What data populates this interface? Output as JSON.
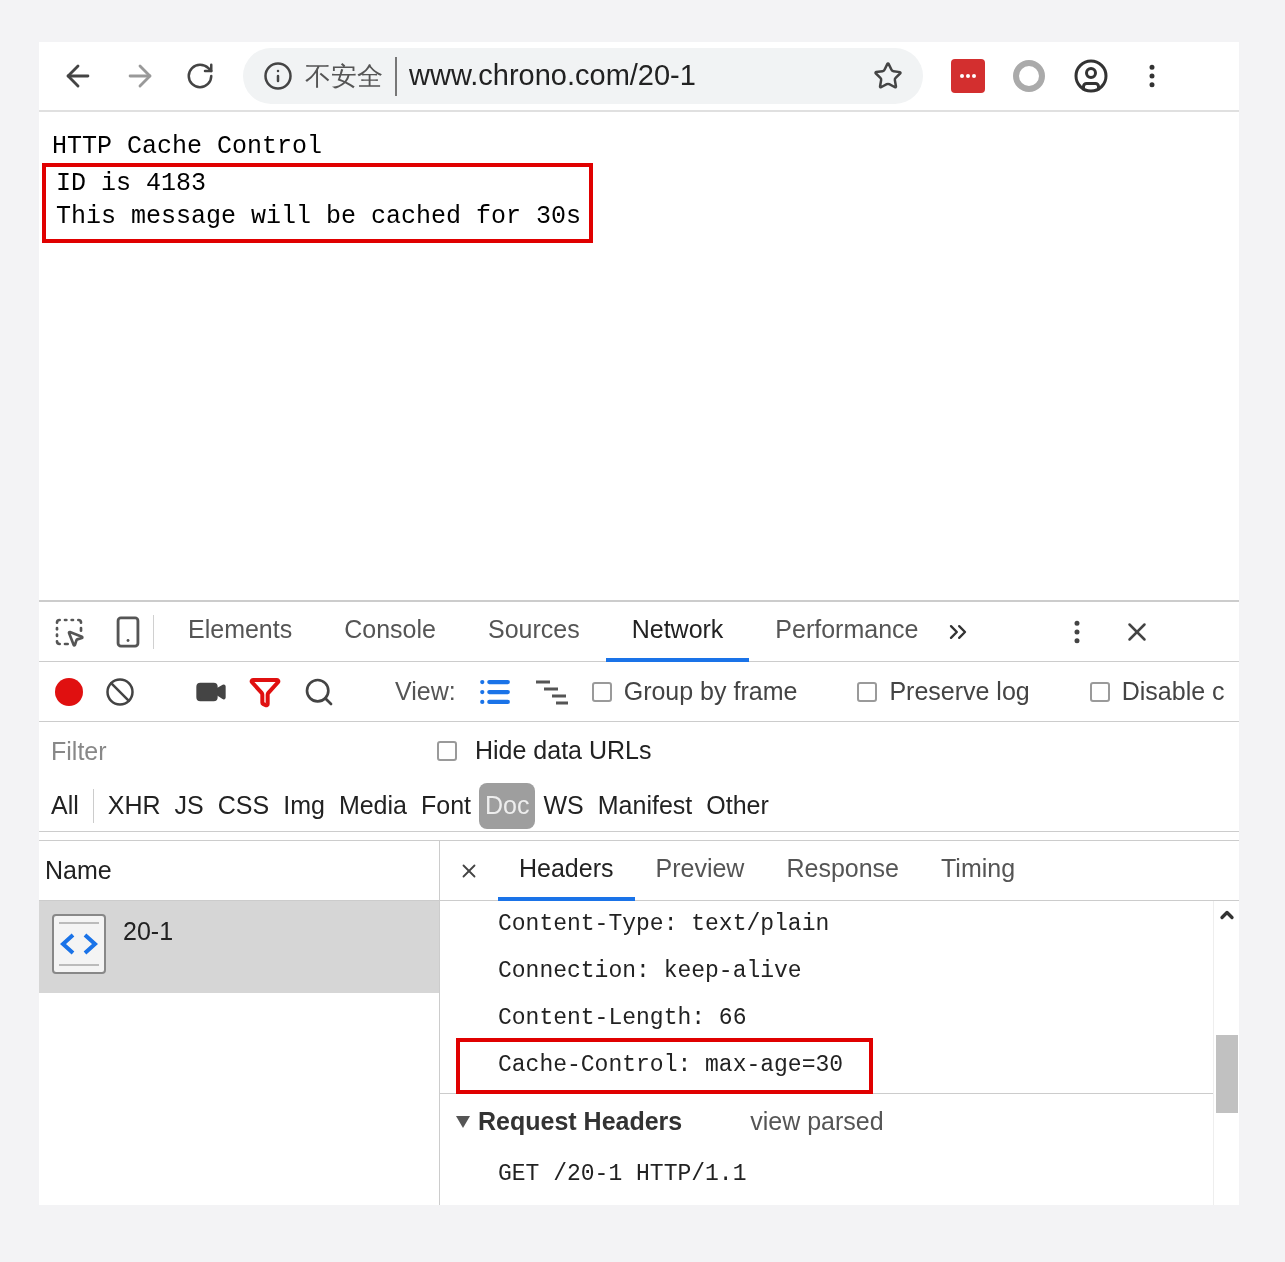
{
  "browser": {
    "security_label": "不安全",
    "url": "www.chrono.com/20-1"
  },
  "page": {
    "title": "HTTP Cache Control",
    "highlighted_lines": [
      "ID is 4183",
      "This message will be cached for 30s"
    ]
  },
  "devtools": {
    "tabs": [
      {
        "label": "Elements",
        "selected": false
      },
      {
        "label": "Console",
        "selected": false
      },
      {
        "label": "Sources",
        "selected": false
      },
      {
        "label": "Network",
        "selected": true
      },
      {
        "label": "Performance",
        "selected": false
      }
    ],
    "toolbar": {
      "recording": true,
      "filter_active": true,
      "view_label": "View:",
      "large_rows": true,
      "checkboxes": [
        {
          "label": "Group by frame",
          "checked": false
        },
        {
          "label": "Preserve log",
          "checked": false
        },
        {
          "label": "Disable c",
          "checked": false
        }
      ]
    },
    "filter": {
      "placeholder": "Filter",
      "hide_data_urls": {
        "label": "Hide data URLs",
        "checked": false
      }
    },
    "types": [
      {
        "label": "All",
        "selected": false
      },
      {
        "label": "XHR",
        "selected": false
      },
      {
        "label": "JS",
        "selected": false
      },
      {
        "label": "CSS",
        "selected": false
      },
      {
        "label": "Img",
        "selected": false
      },
      {
        "label": "Media",
        "selected": false
      },
      {
        "label": "Font",
        "selected": false
      },
      {
        "label": "Doc",
        "selected": true
      },
      {
        "label": "WS",
        "selected": false
      },
      {
        "label": "Manifest",
        "selected": false
      },
      {
        "label": "Other",
        "selected": false
      }
    ],
    "name_column": "Name",
    "requests": [
      {
        "name": "20-1",
        "selected": true
      }
    ],
    "detail_tabs": [
      {
        "label": "Headers",
        "selected": true
      },
      {
        "label": "Preview",
        "selected": false
      },
      {
        "label": "Response",
        "selected": false
      },
      {
        "label": "Timing",
        "selected": false
      }
    ],
    "response_headers": [
      {
        "text": "Content-Type: text/plain",
        "highlighted": false
      },
      {
        "text": "Connection: keep-alive",
        "highlighted": false
      },
      {
        "text": "Content-Length: 66",
        "highlighted": false
      },
      {
        "text": "Cache-Control: max-age=30",
        "highlighted": true
      }
    ],
    "request_headers": {
      "title": "Request Headers",
      "expanded": true,
      "link": "view parsed",
      "lines": [
        "GET /20-1 HTTP/1.1"
      ]
    }
  }
}
